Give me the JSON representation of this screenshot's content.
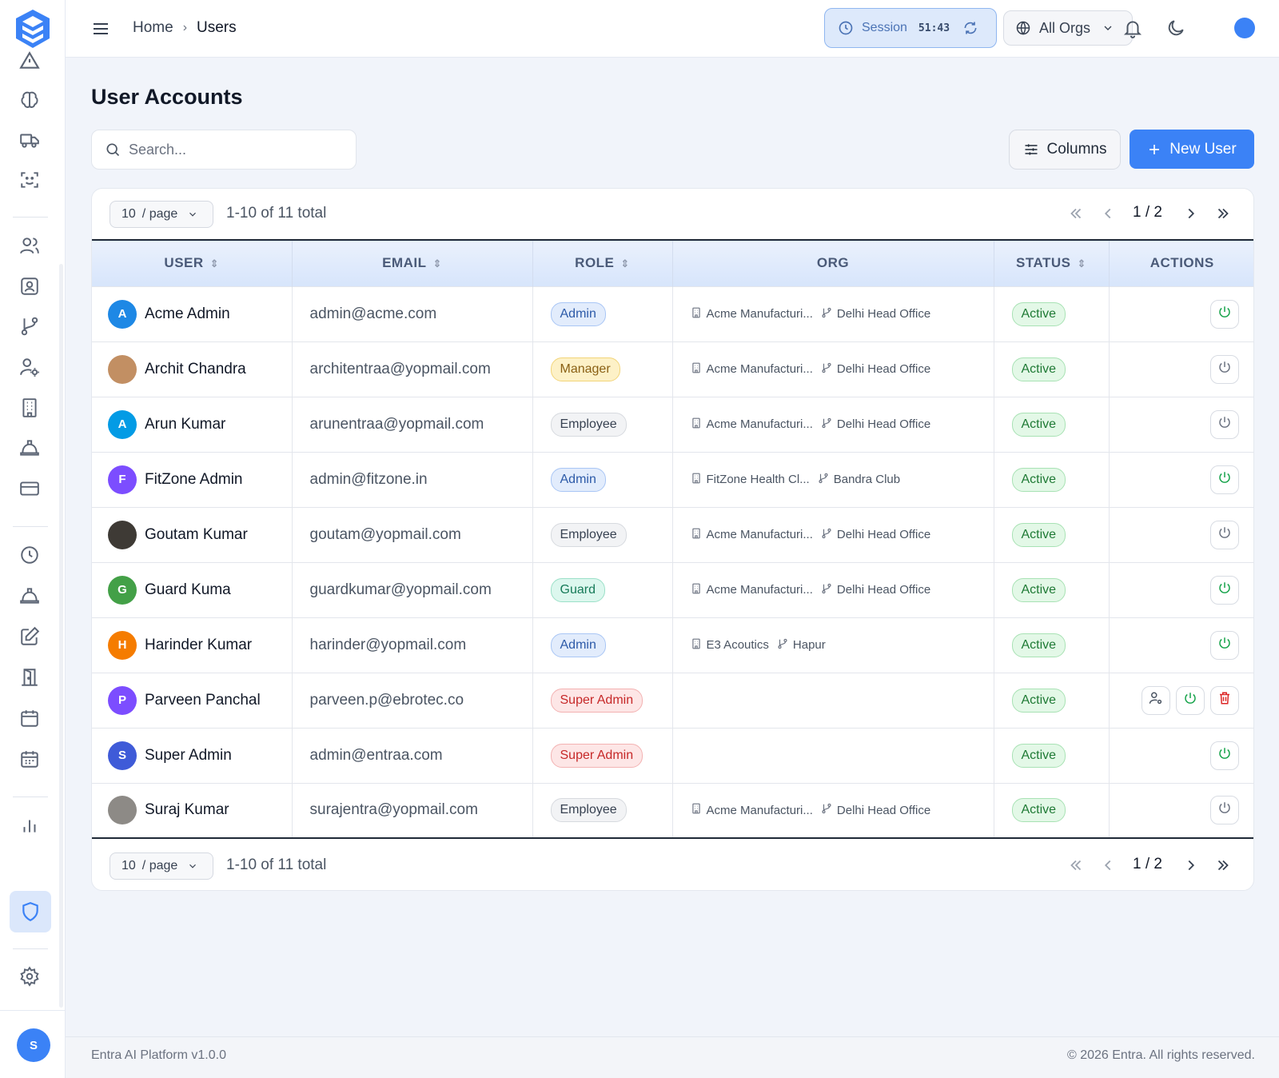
{
  "breadcrumb": {
    "home": "Home",
    "current": "Users"
  },
  "session": {
    "label": "Session",
    "timer": "51:43"
  },
  "org_selector": {
    "label": "All Orgs"
  },
  "page": {
    "title": "User Accounts"
  },
  "search": {
    "placeholder": "Search..."
  },
  "toolbar": {
    "columns_label": "Columns",
    "new_user_label": "New User"
  },
  "pagination": {
    "per_page_value": "10",
    "per_page_suffix": "/ page",
    "total_text": "1-10 of 11 total",
    "page_text": "1 / 2"
  },
  "table": {
    "headers": {
      "user": "USER",
      "email": "EMAIL",
      "role": "ROLE",
      "org": "ORG",
      "status": "STATUS",
      "actions": "ACTIONS"
    },
    "rows": [
      {
        "initial": "A",
        "avatar_color": "#1e88e5",
        "name": "Acme Admin",
        "email": "admin@acme.com",
        "role": "Admin",
        "org": "Acme Manufacturi...",
        "branch": "Delhi Head Office",
        "status": "Active"
      },
      {
        "initial": "",
        "avatar_color": "#c28f63",
        "name": "Archit Chandra",
        "email": "architentraa@yopmail.com",
        "role": "Manager",
        "org": "Acme Manufacturi...",
        "branch": "Delhi Head Office",
        "status": "Active"
      },
      {
        "initial": "A",
        "avatar_color": "#039be5",
        "name": "Arun Kumar",
        "email": "arunentraa@yopmail.com",
        "role": "Employee",
        "org": "Acme Manufacturi...",
        "branch": "Delhi Head Office",
        "status": "Active"
      },
      {
        "initial": "F",
        "avatar_color": "#7c4dff",
        "name": "FitZone Admin",
        "email": "admin@fitzone.in",
        "role": "Admin",
        "org": "FitZone Health Cl...",
        "branch": "Bandra Club",
        "status": "Active"
      },
      {
        "initial": "",
        "avatar_color": "#3e3a35",
        "name": "Goutam Kumar",
        "email": "goutam@yopmail.com",
        "role": "Employee",
        "org": "Acme Manufacturi...",
        "branch": "Delhi Head Office",
        "status": "Active"
      },
      {
        "initial": "G",
        "avatar_color": "#43a047",
        "name": "Guard Kuma",
        "email": "guardkumar@yopmail.com",
        "role": "Guard",
        "org": "Acme Manufacturi...",
        "branch": "Delhi Head Office",
        "status": "Active"
      },
      {
        "initial": "H",
        "avatar_color": "#f57c00",
        "name": "Harinder Kumar",
        "email": "harinder@yopmail.com",
        "role": "Admin",
        "org": "E3 Acoutics",
        "branch": "Hapur",
        "status": "Active"
      },
      {
        "initial": "P",
        "avatar_color": "#7c4dff",
        "name": "Parveen Panchal",
        "email": "parveen.p@ebrotec.co",
        "role": "Super Admin",
        "org": "",
        "branch": "",
        "status": "Active"
      },
      {
        "initial": "S",
        "avatar_color": "#3f5bd8",
        "name": "Super Admin",
        "email": "admin@entraa.com",
        "role": "Super Admin",
        "org": "",
        "branch": "",
        "status": "Active"
      },
      {
        "initial": "",
        "avatar_color": "#8d8a86",
        "name": "Suraj Kumar",
        "email": "surajentra@yopmail.com",
        "role": "Employee",
        "org": "Acme Manufacturi...",
        "branch": "Delhi Head Office",
        "status": "Active"
      }
    ]
  },
  "sidebar": {
    "avatar_initial": "S"
  },
  "footer": {
    "left": "Entra AI Platform v1.0.0",
    "right": "© 2026 Entra. All rights reserved."
  },
  "colors": {
    "accent": "#3b82f6",
    "active_status": "#1f7a35",
    "danger": "#dc2626"
  }
}
